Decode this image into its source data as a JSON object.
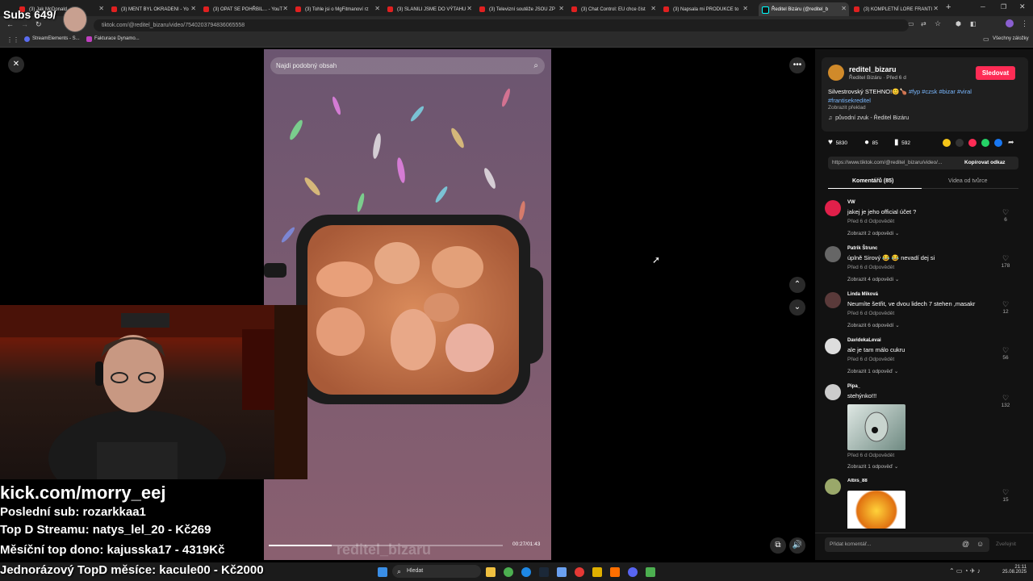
{
  "browser": {
    "tabs": [
      {
        "label": "(3) Jak McDonald"
      },
      {
        "label": "(3) MENT BYL OKRADENI - Yo"
      },
      {
        "label": "(3) OPAT SE POHŘBIL... - YouT"
      },
      {
        "label": "(3) Tohle jsi o MgFitmanoví rz"
      },
      {
        "label": "(3) SLANILI JSME DO VÝTAHU"
      },
      {
        "label": "(3) Televizní soutěže JSOU ZP"
      },
      {
        "label": "(3) Chat Control: EU chce číst"
      },
      {
        "label": "(3) Napsala mi PRODUKCE to"
      },
      {
        "label": "Ředitel Bizáru (@reditel_b"
      },
      {
        "label": "(3) KOMPLETNÍ LORE FRANTI"
      }
    ],
    "url": "tiktok.com/@reditel_bizaru/video/7540203794836065558",
    "bookmarks": [
      "StreamElements - S...",
      "Fakturace Dynamo..."
    ],
    "all_bookmarks": "Všechny záložky"
  },
  "stream_overlay": {
    "subs": "Subs 649/",
    "kick": "kick.com/morry_eej",
    "last_sub": "Poslední sub: rozarkkaa1",
    "top_stream": "Top D Streamu: natys_lel_20 - Kč269",
    "monthly_top": "Měsíční top dono: kajusska17 - 4319Kč",
    "alltime_top": "Jednorázový TopD měsíce: kacule00 - Kč2000"
  },
  "video": {
    "search_placeholder": "Najdi podobný obsah",
    "time": "00:27/01:43",
    "watermark": "reditel_bizaru",
    "progress": 0.27
  },
  "author": {
    "username": "reditel_bizaru",
    "subtitle": "Ředitel Bizáru · Před 6 d",
    "follow": "Sledovat",
    "caption": "Silvestrovský STEHNO!😊🍗",
    "hashtags": "#fyp #czsk #bizar #viral",
    "hashtag2": "#frantisekreditel",
    "translate": "Zobrazit překlad",
    "sound": "původní zvuk - Ředitel Bizáru"
  },
  "stats": {
    "likes": "5830",
    "comments": "85",
    "saves": "592"
  },
  "share": {
    "link": "https://www.tiktok.com/@reditel_bizaru/video/...",
    "copy": "Kopírovat odkaz"
  },
  "tabs": {
    "comments": "Komentářů (85)",
    "creator": "Videa od tvůrce"
  },
  "comments": [
    {
      "user": "VW",
      "text": "jakej je jeho official účet ?",
      "meta": "Před 6 d   Odpovědět",
      "replies": "Zobrazit 2 odpovědi ⌄",
      "likes": "6"
    },
    {
      "user": "Patrik Štrunc",
      "text": "úplně Sirový 😂 😂 nevadí dej si",
      "meta": "Před 6 d   Odpovědět",
      "replies": "Zobrazit 4 odpovědi ⌄",
      "likes": "178"
    },
    {
      "user": "Linda Miková",
      "text": "Neumíte šetřit, ve dvou lidech 7 stehen ,masakr",
      "meta": "Před 6 d   Odpovědět",
      "replies": "Zobrazit 6 odpovědí ⌄",
      "likes": "12"
    },
    {
      "user": "DavidekaLevai",
      "text": "ale je tam málo cukru",
      "meta": "Před 6 d   Odpovědět",
      "replies": "Zobrazit 1 odpověď ⌄",
      "likes": "56"
    },
    {
      "user": "Pipa_",
      "text": "stehýnko!!!",
      "meta": "Před 6 d   Odpovědět",
      "replies": "Zobrazit 1 odpověď ⌄",
      "likes": "132"
    },
    {
      "user": "Albis_88",
      "text": "",
      "meta": "",
      "replies": "",
      "likes": "15"
    }
  ],
  "composer": {
    "placeholder": "Přidat komentář...",
    "post": "Zveřejnit"
  },
  "taskbar": {
    "search": "Hledat",
    "time": "21:11",
    "date": "25.08.2025"
  },
  "colors": {
    "accent": "#fe2c55",
    "panel": "#121212",
    "link": "#7ab8ff"
  }
}
